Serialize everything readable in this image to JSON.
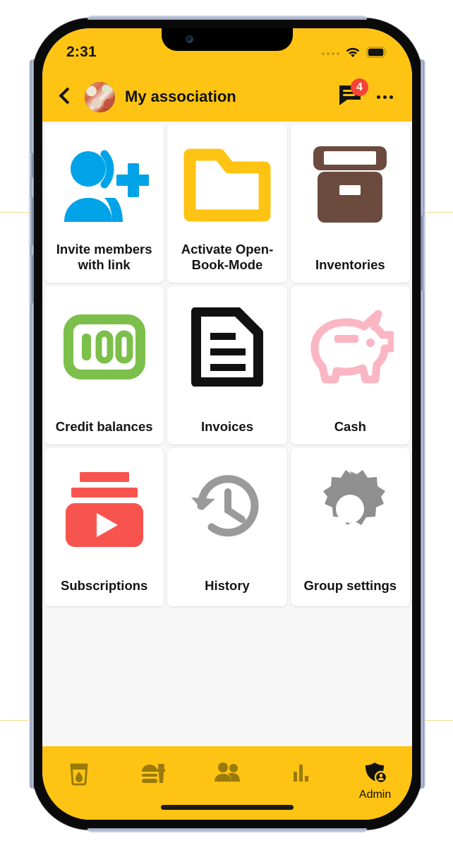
{
  "theme": {
    "brand_yellow": "#FFC413",
    "screen_bg": "#F7F7F7",
    "tile_bg": "#FFFFFF",
    "badge_red": "#F54336",
    "nav_icon_inactive": "#9A7A0B",
    "nav_icon_active": "#111111"
  },
  "status_bar": {
    "clock": "2:31",
    "signal_icon": "signal-dots-icon",
    "wifi_icon": "wifi-icon",
    "battery_icon": "battery-full-icon"
  },
  "app_bar": {
    "back_icon": "chevron-left-icon",
    "avatar_icon": "group-avatar-photo",
    "title": "My association",
    "chat_icon": "chat-bubble-icon",
    "chat_badge_count": "4",
    "more_icon": "more-horizontal-icon"
  },
  "grid": {
    "tiles": [
      {
        "label": "Invite members with link",
        "icon": "person-add-icon",
        "color": "#00A3E8"
      },
      {
        "label": "Activate Open-Book-Mode",
        "icon": "open-folder-icon",
        "color": "#FFC413"
      },
      {
        "label": "Inventories",
        "icon": "storage-box-icon",
        "color": "#6B4B3E"
      },
      {
        "label": "Credit balances",
        "icon": "banknote-100-icon",
        "color": "#7CBF4B"
      },
      {
        "label": "Invoices",
        "icon": "document-lines-icon",
        "color": "#111111"
      },
      {
        "label": "Cash",
        "icon": "piggy-bank-icon",
        "color": "#FBB6C4"
      },
      {
        "label": "Subscriptions",
        "icon": "subscriptions-play-icon",
        "color": "#F8544F"
      },
      {
        "label": "History",
        "icon": "history-clock-icon",
        "color": "#9A9A9A"
      },
      {
        "label": "Group settings",
        "icon": "gear-icon",
        "color": "#8F8F8F"
      }
    ]
  },
  "bottom_nav": {
    "items": [
      {
        "icon": "drink-glass-icon",
        "label": "",
        "active": false
      },
      {
        "icon": "fast-food-icon",
        "label": "",
        "active": false
      },
      {
        "icon": "people-icon",
        "label": "",
        "active": false
      },
      {
        "icon": "bar-chart-icon",
        "label": "",
        "active": false
      },
      {
        "icon": "admin-shield-icon",
        "label": "Admin",
        "active": true
      }
    ]
  }
}
